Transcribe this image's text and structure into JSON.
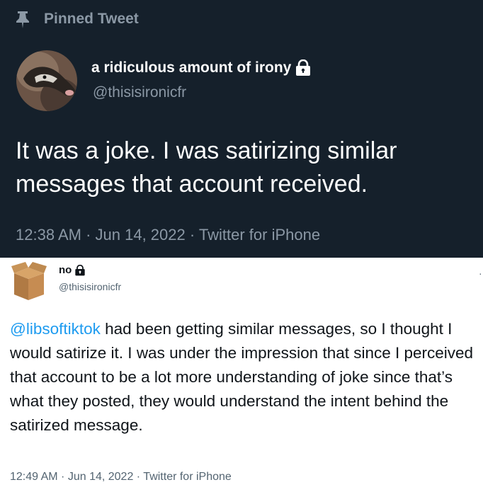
{
  "pinned_label": "Pinned Tweet",
  "tweet1": {
    "name": "a ridiculous amount of irony",
    "handle": "@thisisironicfr",
    "text": "It was a joke. I was satirizing similar messages that account received.",
    "time": "12:38 AM",
    "date": "Jun 14, 2022",
    "source": "Twitter for iPhone"
  },
  "tweet2": {
    "name": "no",
    "handle": "@thisisironicfr",
    "mention": "@libsoftiktok",
    "text": " had been getting similar messages, so I thought I would satirize it. I was under the impression that since I perceived that account to be a lot more understanding of joke since that’s what they posted, they would understand the intent behind the satirized message.",
    "time": "12:49 AM",
    "date": "Jun 14, 2022",
    "source": "Twitter for iPhone",
    "more_label": "·"
  },
  "separator": " · ",
  "icons": {
    "pin": "pin-icon",
    "lock": "lock-icon",
    "avatar1": "dog-avatar",
    "avatar2": "cardboard-box-avatar"
  },
  "colors": {
    "dark_bg": "#15202b",
    "muted": "#8b98a5",
    "link": "#1d9bf0"
  }
}
